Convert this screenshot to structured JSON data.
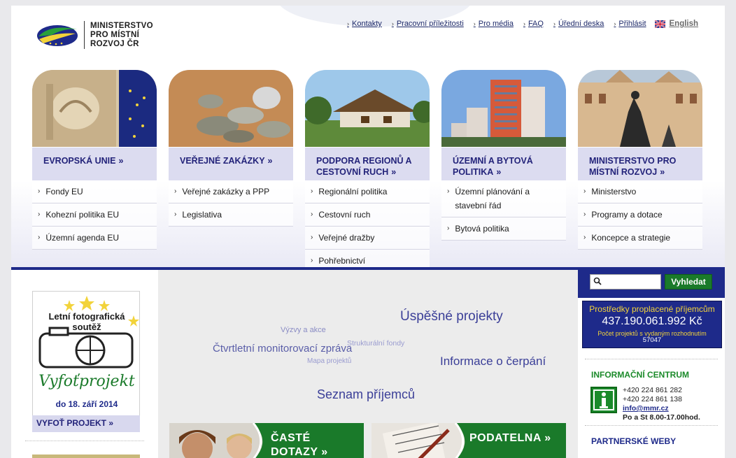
{
  "logo": {
    "lines": [
      "MINISTERSTVO",
      "PRO MÍSTNÍ",
      "ROZVOJ ČR"
    ]
  },
  "topnav": {
    "items": [
      "Kontakty",
      "Pracovní příležitosti",
      "Pro média",
      "FAQ",
      "Úřední deska",
      "Přihlásit"
    ],
    "language": "English"
  },
  "columns": [
    {
      "title": "EVROPSKÁ UNIE",
      "arrow": "»",
      "image_icon": "eu-flag-building-photo",
      "items": [
        "Fondy EU",
        "Kohezní politika EU",
        "Územní agenda EU"
      ]
    },
    {
      "title": "VEŘEJNÉ ZAKÁZKY",
      "arrow": "»",
      "image_icon": "coins-photo",
      "items": [
        "Veřejné zakázky a PPP",
        "Legislativa"
      ]
    },
    {
      "title": "PODPORA REGIONŮ A CESTOVNÍ RUCH",
      "arrow": "»",
      "image_icon": "village-houses-photo",
      "items": [
        "Regionální politika",
        "Cestovní ruch",
        "Veřejné dražby",
        "Pohřebnictví"
      ]
    },
    {
      "title": "ÚZEMNÍ A BYTOVÁ POLITIKA",
      "arrow": "»",
      "image_icon": "apartment-buildings-photo",
      "items": [
        "Územní plánování a stavební řád",
        "Bytová politika"
      ]
    },
    {
      "title": "MINISTERSTVO PRO MÍSTNÍ ROZVOJ",
      "arrow": "»",
      "image_icon": "town-square-statue-photo",
      "items": [
        "Ministerstvo",
        "Programy a dotace",
        "Koncepce a strategie"
      ]
    }
  ],
  "contest": {
    "title_line1": "Letní fotografická",
    "title_line2": "soutěž",
    "script_text": "Vyfoťprojekt",
    "date": "do 18. září 2014",
    "link": "VYFOŤ PROJEKT »"
  },
  "tag_cloud": [
    {
      "text": "Úspěšné projekty"
    },
    {
      "text": "Výzvy a akce"
    },
    {
      "text": "Čtvrtletní monitorovací zpráva"
    },
    {
      "text": "Strukturální fondy"
    },
    {
      "text": "Mapa projektů"
    },
    {
      "text": "Informace o čerpání"
    },
    {
      "text": "Seznam příjemců"
    }
  ],
  "tiles": [
    {
      "label_line1": "ČASTÉ",
      "label_line2": "DOTAZY »"
    },
    {
      "label_line1": "PODATELNA »",
      "label_line2": ""
    }
  ],
  "search": {
    "button": "Vyhledat",
    "placeholder": ""
  },
  "funds": {
    "title": "Prostředky proplacené příjemcům",
    "amount": "437.190.061.992 Kč",
    "sub": "Počet projektů s vydaným rozhodnutím",
    "count": "57047"
  },
  "info_center": {
    "title": "INFORMAČNÍ CENTRUM",
    "phone1": "+420 224 861 282",
    "phone2": "+420 224 861 138",
    "email": "info@mmr.cz",
    "hours": "Po a St 8.00-17.00hod."
  },
  "partners": {
    "title": "PARTNERSKÉ WEBY"
  },
  "colors": {
    "navy": "#1e2a8a",
    "green": "#1a8a2a",
    "gold": "#f2d33a",
    "lavender": "#dcdcf0"
  }
}
